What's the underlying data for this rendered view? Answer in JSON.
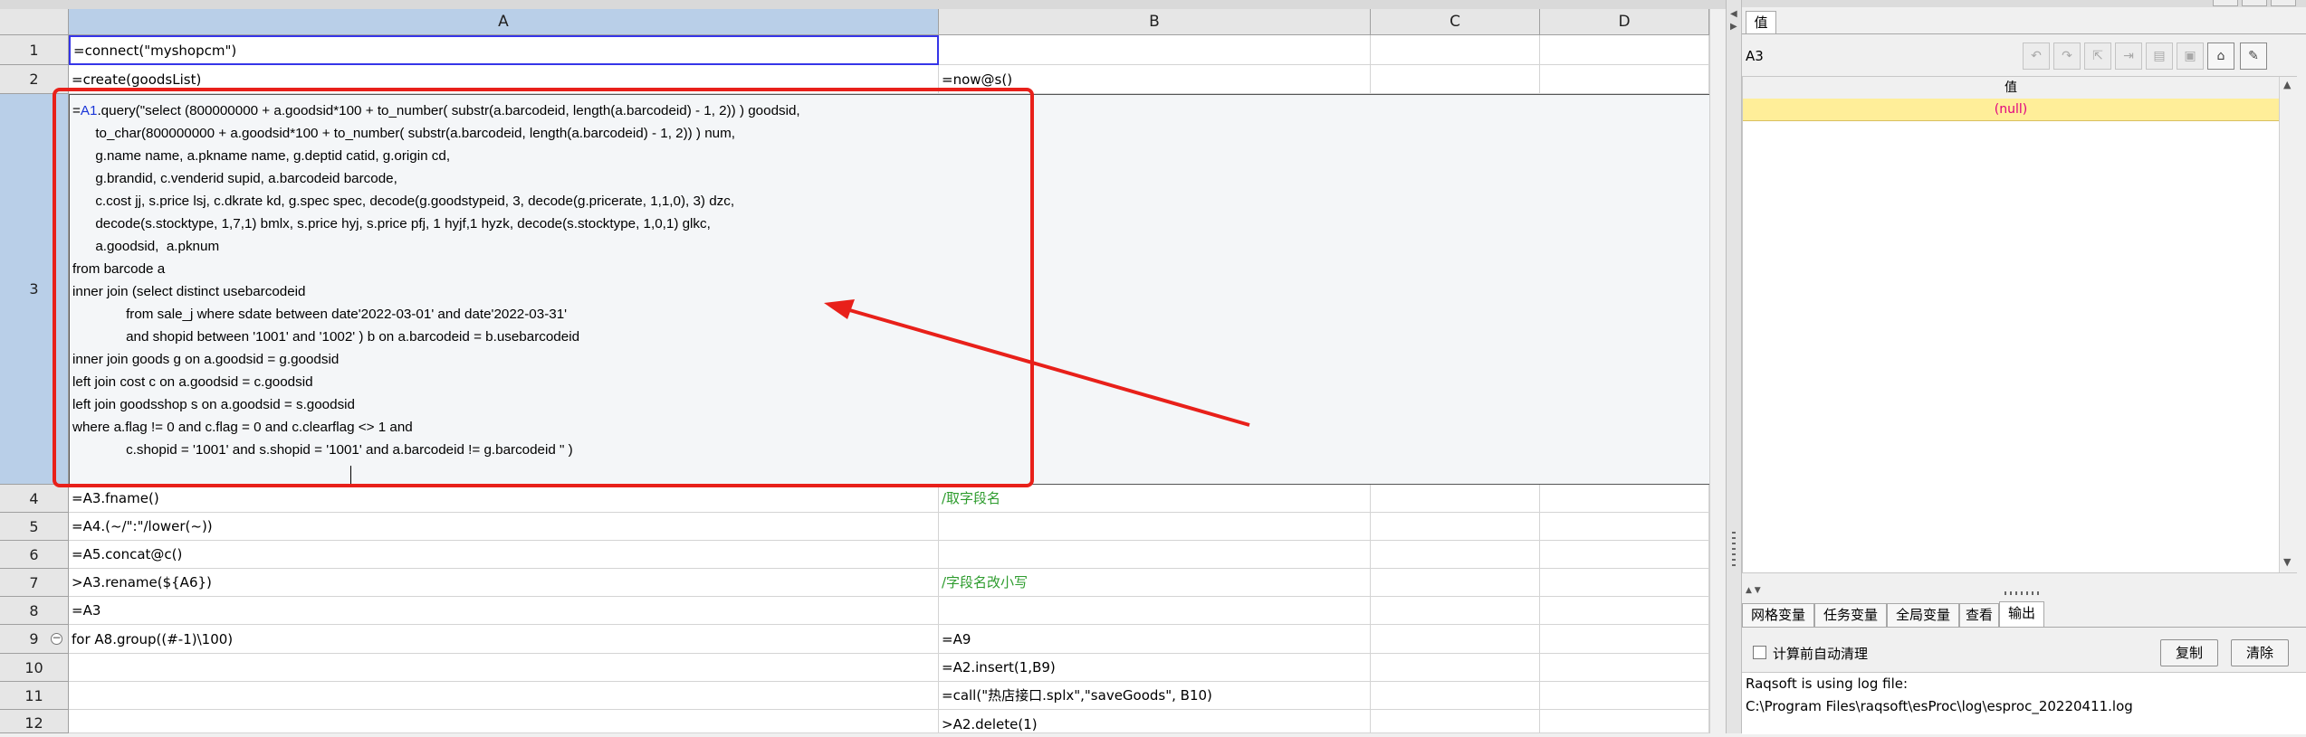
{
  "columns": [
    "A",
    "B",
    "C",
    "D"
  ],
  "rows": [
    "1",
    "2",
    "3",
    "4",
    "5",
    "6",
    "7",
    "8",
    "9",
    "10",
    "11",
    "12"
  ],
  "cells": {
    "A1": "=connect(\"myshopcm\")",
    "A2": "=create(goodsList)",
    "B2": "=now@s()",
    "A3": {
      "prefix": "=",
      "ref": "A1",
      "text": ".query(\"select (800000000 + a.goodsid*100 + to_number( substr(a.barcodeid, length(a.barcodeid) - 1, 2)) ) goodsid,\n      to_char(800000000 + a.goodsid*100 + to_number( substr(a.barcodeid, length(a.barcodeid) - 1, 2)) ) num,\n      g.name name, a.pkname name, g.deptid catid, g.origin cd,\n      g.brandid, c.venderid supid, a.barcodeid barcode,\n      c.cost jj, s.price lsj, c.dkrate kd, g.spec spec, decode(g.goodstypeid, 3, decode(g.pricerate, 1,1,0), 3) dzc,\n      decode(s.stocktype, 1,7,1) bmlx, s.price hyj, s.price pfj, 1 hyjf,1 hyzk, decode(s.stocktype, 1,0,1) glkc,\n      a.goodsid,  a.pknum\nfrom barcode a\ninner join (select distinct usebarcodeid\n              from sale_j where sdate between date'2022-03-01' and date'2022-03-31'\n              and shopid between '1001' and '1002' ) b on a.barcodeid = b.usebarcodeid\ninner join goods g on a.goodsid = g.goodsid\nleft join cost c on a.goodsid = c.goodsid\nleft join goodsshop s on a.goodsid = s.goodsid\nwhere a.flag != 0 and c.flag = 0 and c.clearflag <> 1 and\n              c.shopid = '1001' and s.shopid = '1001' and a.barcodeid != g.barcodeid \" )"
    },
    "A4": "=A3.fname()",
    "B4": "/取字段名",
    "A5": "=A4.(~/\":\"/lower(~))",
    "A6": "=A5.concat@c()",
    "A7": ">A3.rename(${A6})",
    "B7": "/字段名改小写",
    "A8": "=A3",
    "A9": "for A8.group((#-1)\\100)",
    "B9": "=A9",
    "B10": "=A2.insert(1,B9)",
    "B11": "=call(\"热店接口.splx\",\"saveGoods\", B10)",
    "B12": ">A2.delete(1)"
  },
  "right_panel": {
    "top_tab": "值",
    "cell_name": "A3",
    "value_header": "值",
    "value": "(null)",
    "bottom_tabs": [
      "网格变量",
      "任务变量",
      "全局变量",
      "查看",
      "输出"
    ],
    "active_bottom_tab": "输出",
    "auto_clear_label": "计算前自动清理",
    "auto_clear_checked": false,
    "copy_button": "复制",
    "clear_button": "清除",
    "log_lines": [
      "Raqsoft is using log file:",
      "C:\\Program Files\\raqsoft\\esProc\\log\\esproc_20220411.log"
    ]
  },
  "toolbar_icons": [
    "undo-icon",
    "redo-icon",
    "tool-icon-3",
    "tool-icon-4",
    "tool-icon-5",
    "tool-icon-6",
    "lock-icon",
    "pin-icon"
  ],
  "colors": {
    "comment": "#2e9c2e",
    "annotation": "#e8201a",
    "selected_header": "#b9cfe8",
    "value_row": "#ffee99",
    "null_text": "#e0007f"
  }
}
